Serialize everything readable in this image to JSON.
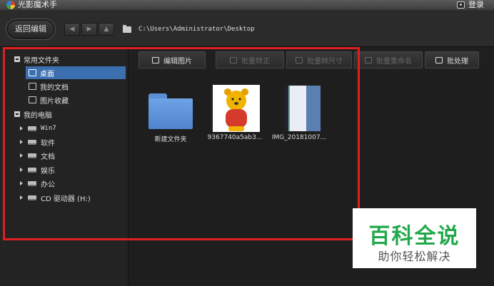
{
  "window": {
    "title": "光影魔术手",
    "login_label": "登录"
  },
  "toolbar": {
    "back_label": "返回编辑",
    "path": "C:\\Users\\Administrator\\Desktop"
  },
  "sidebar": {
    "favorites": {
      "label": "常用文件夹",
      "items": [
        {
          "label": "桌面",
          "selected": true
        },
        {
          "label": "我的文档",
          "selected": false
        },
        {
          "label": "图片收藏",
          "selected": false
        }
      ]
    },
    "computer": {
      "label": "我的电脑",
      "items": [
        {
          "label": "Win7"
        },
        {
          "label": "软件"
        },
        {
          "label": "文档"
        },
        {
          "label": "娱乐"
        },
        {
          "label": "办公"
        },
        {
          "label": "CD 驱动器 (H:)"
        }
      ]
    }
  },
  "actions": [
    {
      "label": "编辑图片",
      "enabled": true
    },
    {
      "label": "批量转正",
      "enabled": false
    },
    {
      "label": "批量转尺寸",
      "enabled": false
    },
    {
      "label": "批量重命名",
      "enabled": false
    },
    {
      "label": "批处理",
      "enabled": true
    }
  ],
  "files": [
    {
      "name": "新建文件夹",
      "kind": "folder"
    },
    {
      "name": "9367740a5ab3...",
      "kind": "image"
    },
    {
      "name": "IMG_20181007...",
      "kind": "image"
    }
  ],
  "watermark": {
    "main": "百科全说",
    "sub": "助你轻松解决"
  },
  "colors": {
    "selected": "#3c6fb0",
    "annotation": "#e02020",
    "watermark_green": "#22a84a"
  }
}
